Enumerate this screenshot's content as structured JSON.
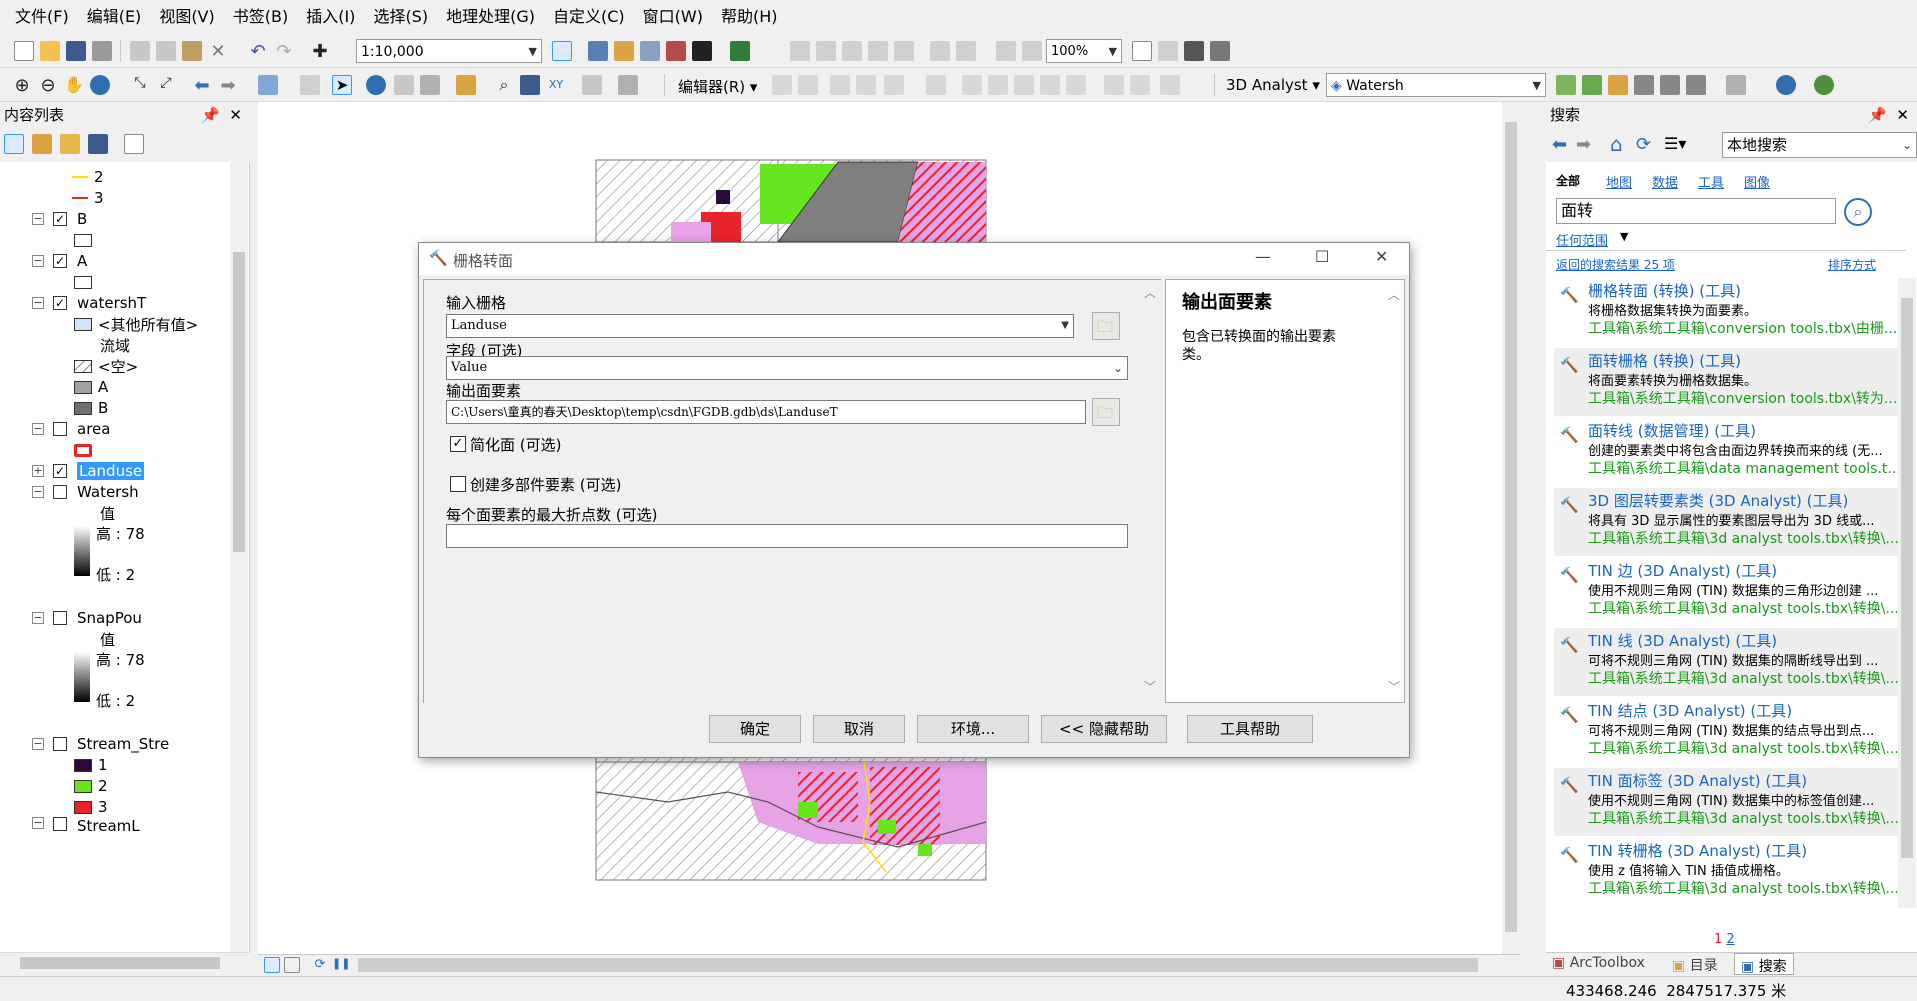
{
  "menu": [
    "文件(F)",
    "编辑(E)",
    "视图(V)",
    "书签(B)",
    "插入(I)",
    "选择(S)",
    "地理处理(G)",
    "自定义(C)",
    "窗口(W)",
    "帮助(H)"
  ],
  "toolbar": {
    "scale_value": "1:10,000",
    "zoom_value": "100%",
    "editor_label": "编辑器(R)",
    "analyst_label": "3D Analyst",
    "layer_select": "Watersh"
  },
  "toc": {
    "title": "内容列表",
    "rows": [
      {
        "label": "2"
      },
      {
        "label": "3"
      },
      {
        "label": "B"
      },
      {
        "label": ""
      },
      {
        "label": "A"
      },
      {
        "label": ""
      },
      {
        "label": "watershT"
      },
      {
        "label": "<其他所有值>"
      },
      {
        "label": "流域"
      },
      {
        "label": "<空>"
      },
      {
        "label": "A"
      },
      {
        "label": "B"
      },
      {
        "label": "area"
      },
      {
        "label": ""
      },
      {
        "label": "Landuse"
      },
      {
        "label": "Watersh"
      },
      {
        "label": "值"
      },
      {
        "label": "高 : 78"
      },
      {
        "label": "低 : 2"
      },
      {
        "label": "SnapPou"
      },
      {
        "label": "值"
      },
      {
        "label": "高 : 78"
      },
      {
        "label": "低 : 2"
      },
      {
        "label": "Stream_Stre"
      },
      {
        "label": "1"
      },
      {
        "label": "2"
      },
      {
        "label": "3"
      },
      {
        "label": "StreamL"
      }
    ]
  },
  "dialog": {
    "title": "栅格转面",
    "input_raster_label": "输入栅格",
    "input_raster_value": "Landuse",
    "field_label": "字段 (可选)",
    "field_value": "Value",
    "output_label": "输出面要素",
    "output_value": "C:\\Users\\童真的春天\\Desktop\\temp\\csdn\\FGDB.gdb\\ds\\LanduseT",
    "simplify_label": "简化面 (可选)",
    "multipart_label": "创建多部件要素 (可选)",
    "max_vertices_label": "每个面要素的最大折点数 (可选)",
    "max_vertices_value": "",
    "help_title": "输出面要素",
    "help_text": "包含已转换面的输出要素类。",
    "buttons": {
      "ok": "确定",
      "cancel": "取消",
      "env": "环境...",
      "hide_help": "<< 隐藏帮助",
      "tool_help": "工具帮助"
    }
  },
  "search": {
    "title": "搜索",
    "scope": "本地搜索",
    "tabs": [
      "全部",
      "地图",
      "数据",
      "工具",
      "图像"
    ],
    "query": "面转",
    "any_extent": "任何范围",
    "results_count": "返回的搜索结果 25 项",
    "sort": "排序方式",
    "results": [
      {
        "title": "栅格转面 (转换) (工具)",
        "desc": "将栅格数据集转换为面要素。",
        "path": "工具箱\\系统工具箱\\conversion tools.tbx\\由栅..."
      },
      {
        "title": "面转栅格 (转换) (工具)",
        "desc": "将面要素转换为栅格数据集。",
        "path": "工具箱\\系统工具箱\\conversion tools.tbx\\转为..."
      },
      {
        "title": "面转线 (数据管理) (工具)",
        "desc": "创建的要素类中将包含由面边界转换而来的线 (无...",
        "path": "工具箱\\系统工具箱\\data management tools.t..."
      },
      {
        "title": "3D 图层转要素类 (3D Analyst) (工具)",
        "desc": "将具有 3D 显示属性的要素图层导出为 3D 线或...",
        "path": "工具箱\\系统工具箱\\3d analyst tools.tbx\\转换\\..."
      },
      {
        "title": "TIN 边 (3D Analyst) (工具)",
        "desc": "使用不规则三角网 (TIN) 数据集的三角形边创建 ...",
        "path": "工具箱\\系统工具箱\\3d analyst tools.tbx\\转换\\..."
      },
      {
        "title": "TIN 线 (3D Analyst) (工具)",
        "desc": "可将不规则三角网 (TIN) 数据集的隔断线导出到 ...",
        "path": "工具箱\\系统工具箱\\3d analyst tools.tbx\\转换\\..."
      },
      {
        "title": "TIN 结点 (3D Analyst) (工具)",
        "desc": "可将不规则三角网 (TIN) 数据集的结点导出到点...",
        "path": "工具箱\\系统工具箱\\3d analyst tools.tbx\\转换\\..."
      },
      {
        "title": "TIN 面标签 (3D Analyst) (工具)",
        "desc": "使用不规则三角网 (TIN) 数据集中的标签值创建...",
        "path": "工具箱\\系统工具箱\\3d analyst tools.tbx\\转换\\..."
      },
      {
        "title": "TIN 转栅格 (3D Analyst) (工具)",
        "desc": "使用 z 值将输入 TIN 插值成栅格。",
        "path": "工具箱\\系统工具箱\\3d analyst tools.tbx\\转换\\..."
      }
    ],
    "pages": [
      "1",
      "2"
    ],
    "bottom_tabs": [
      "ArcToolbox",
      "目录",
      "搜索"
    ]
  },
  "status": {
    "coords": "433468.246  2847517.375 米"
  },
  "colors": {
    "selection": "#3399ff",
    "link": "#1a64c8",
    "path": "#1a9a1a",
    "red": "#e8232a",
    "green": "#66e61e",
    "pink": "#e7a3e6",
    "gray": "#7f7f7f"
  }
}
